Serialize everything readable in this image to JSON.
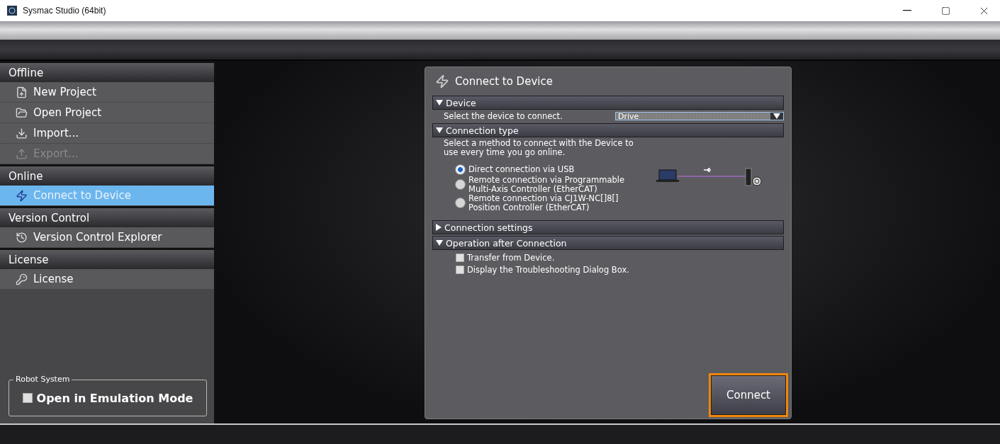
{
  "window": {
    "title": "Sysmac Studio (64bit)"
  },
  "sidebar": {
    "sections": [
      {
        "title": "Offline",
        "items": [
          {
            "label": "New Project",
            "disabled": false,
            "selected": false
          },
          {
            "label": "Open Project",
            "disabled": false,
            "selected": false
          },
          {
            "label": "Import...",
            "disabled": false,
            "selected": false
          },
          {
            "label": "Export...",
            "disabled": true,
            "selected": false
          }
        ]
      },
      {
        "title": "Online",
        "items": [
          {
            "label": "Connect to Device",
            "disabled": false,
            "selected": true
          }
        ]
      },
      {
        "title": "Version Control",
        "items": [
          {
            "label": "Version Control Explorer",
            "disabled": false,
            "selected": false
          }
        ]
      },
      {
        "title": "License",
        "items": [
          {
            "label": "License",
            "disabled": false,
            "selected": false
          }
        ]
      }
    ],
    "robot_system": {
      "title": "Robot System",
      "option": {
        "label": "Open in Emulation Mode",
        "checked": false
      }
    }
  },
  "dialog": {
    "title": "Connect to Device",
    "sections": [
      {
        "kind": "select",
        "title": "Device",
        "expanded": true,
        "prompt": "Select the device to connect.",
        "value": "Drive"
      },
      {
        "kind": "radio",
        "title": "Connection type",
        "expanded": true,
        "description": "Select a method to connect with the Device to use every time you go online.",
        "options": [
          {
            "label": "Direct connection via USB",
            "selected": true
          },
          {
            "label": "Remote connection via Programmable Multi-Axis Controller (EtherCAT)",
            "selected": false
          },
          {
            "label": "Remote connection via CJ1W-NC[]8[] Position Controller (EtherCAT)",
            "selected": false
          }
        ]
      },
      {
        "title": "Connection settings",
        "expanded": false
      },
      {
        "kind": "checks",
        "title": "Operation after Connection",
        "expanded": true,
        "items": [
          {
            "label": "Transfer from Device.",
            "checked": false
          },
          {
            "label": "Display the Troubleshooting Dialog Box.",
            "checked": false
          }
        ]
      }
    ],
    "connect_button": "Connect"
  }
}
